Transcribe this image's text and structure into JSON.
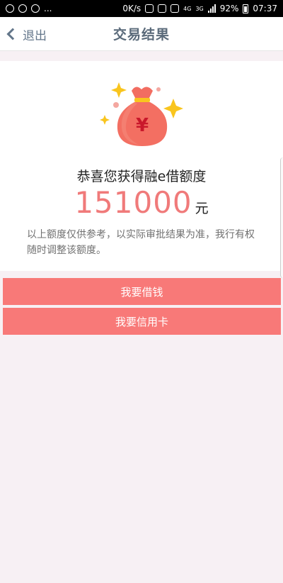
{
  "status_bar": {
    "net_speed": "0K/s",
    "battery": "92%",
    "time": "07:37",
    "net_4g": "4G",
    "net_3g": "3G",
    "dots": "..."
  },
  "header": {
    "back_label": "退出",
    "title": "交易结果"
  },
  "result": {
    "message": "恭喜您获得融e借额度",
    "amount": "151000",
    "unit": "元",
    "note": "以上额度仅供参考，以实际审批结果为准，我行有权随时调整该额度。",
    "bag_symbol": "¥"
  },
  "actions": {
    "borrow_label": "我要借钱",
    "credit_card_label": "我要信用卡"
  },
  "colors": {
    "accent": "#f87978",
    "amount": "#f07a7a"
  }
}
